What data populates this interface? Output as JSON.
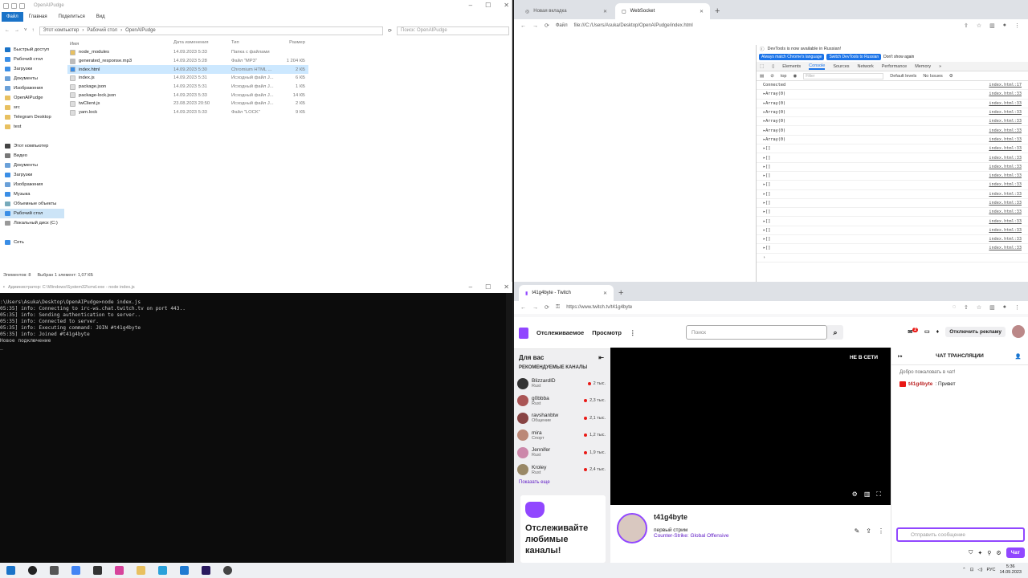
{
  "explorer": {
    "title": "OpenAIPudge",
    "ribbon": [
      "Файл",
      "Главная",
      "Поделиться",
      "Вид"
    ],
    "path": [
      "Этот компьютер",
      "Рабочий стол",
      "OpenAIPudge"
    ],
    "search_placeholder": "Поиск: OpenAIPudge",
    "nav": [
      {
        "label": "Быстрый доступ",
        "icon": "star-icon"
      },
      {
        "label": "Рабочий стол",
        "icon": "desktop-folder-icon"
      },
      {
        "label": "Загрузки",
        "icon": "download-folder-icon"
      },
      {
        "label": "Документы",
        "icon": "documents-folder-icon"
      },
      {
        "label": "Изображения",
        "icon": "pictures-folder-icon"
      },
      {
        "label": "OpenAIPudge",
        "icon": "folder-icon"
      },
      {
        "label": "src",
        "icon": "folder-icon"
      },
      {
        "label": "Telegram Desktop",
        "icon": "folder-icon"
      },
      {
        "label": "test",
        "icon": "folder-icon"
      },
      {
        "label": "",
        "icon": ""
      },
      {
        "label": "Этот компьютер",
        "icon": "computer-icon"
      },
      {
        "label": "Видео",
        "icon": "video-folder-icon"
      },
      {
        "label": "Документы",
        "icon": "documents-folder-icon"
      },
      {
        "label": "Загрузки",
        "icon": "download-folder-icon"
      },
      {
        "label": "Изображения",
        "icon": "pictures-folder-icon"
      },
      {
        "label": "Музыка",
        "icon": "music-icon"
      },
      {
        "label": "Объемные объекты",
        "icon": "3d-objects-icon"
      },
      {
        "label": "Рабочий стол",
        "icon": "desktop-folder-icon"
      },
      {
        "label": "Локальный диск (C:)",
        "icon": "disk-icon"
      },
      {
        "label": "",
        "icon": ""
      },
      {
        "label": "Сеть",
        "icon": "network-icon"
      }
    ],
    "columns": [
      "Имя",
      "Дата изменения",
      "Тип",
      "Размер"
    ],
    "files": [
      {
        "name": "node_modules",
        "date": "14.09.2023 5:33",
        "type": "Папка с файлами",
        "size": ""
      },
      {
        "name": "generated_response.mp3",
        "date": "14.09.2023 5:28",
        "type": "Файл \"MP3\"",
        "size": "1 204 КБ"
      },
      {
        "name": "index.html",
        "date": "14.09.2023 5:30",
        "type": "Chromium HTML ...",
        "size": "2 КБ"
      },
      {
        "name": "index.js",
        "date": "14.09.2023 5:31",
        "type": "Исходный файл J...",
        "size": "6 КБ"
      },
      {
        "name": "package.json",
        "date": "14.09.2023 5:31",
        "type": "Исходный файл J...",
        "size": "1 КБ"
      },
      {
        "name": "package-lock.json",
        "date": "14.09.2023 5:33",
        "type": "Исходный файл J...",
        "size": "14 КБ"
      },
      {
        "name": "twClient.js",
        "date": "23.08.2023 20:50",
        "type": "Исходный файл J...",
        "size": "2 КБ"
      },
      {
        "name": "yarn.lock",
        "date": "14.09.2023 5:33",
        "type": "Файл \"LOCK\"",
        "size": "9 КБ"
      }
    ],
    "status_items": "Элементов: 8",
    "status_selected": "Выбран 1 элемент: 1,07 КБ"
  },
  "browser1": {
    "tabs": [
      "Новая вкладка",
      "WebSocket"
    ],
    "url_prefix": "Файл",
    "url": "file:///C:/Users/Asuka/Desktop/OpenAIPudge/index.html",
    "devtools_banner": "DevTools is now available in Russian!",
    "btn_match": "Always match Chrome's language",
    "btn_switch": "Switch DevTools to Russian",
    "btn_dont": "Don't show again",
    "dt_tabs": [
      "Elements",
      "Console",
      "Sources",
      "Network",
      "Performance",
      "Memory"
    ],
    "context": "top",
    "filter_placeholder": "Filter",
    "levels": "Default levels",
    "issues": "No Issues",
    "console": [
      {
        "text": "Connected",
        "src": "index.html:17"
      },
      {
        "text": "▸Array(0)",
        "src": "index.html:33"
      },
      {
        "text": "▸Array(0)",
        "src": "index.html:33"
      },
      {
        "text": "▸Array(0)",
        "src": "index.html:33"
      },
      {
        "text": "▸Array(0)",
        "src": "index.html:33"
      },
      {
        "text": "▸Array(0)",
        "src": "index.html:33"
      },
      {
        "text": "▸Array(0)",
        "src": "index.html:33"
      },
      {
        "text": "▸[]",
        "src": "index.html:33"
      },
      {
        "text": "▸[]",
        "src": "index.html:33"
      },
      {
        "text": "▸[]",
        "src": "index.html:33"
      },
      {
        "text": "▸[]",
        "src": "index.html:33"
      },
      {
        "text": "▸[]",
        "src": "index.html:33"
      },
      {
        "text": "▸[]",
        "src": "index.html:33"
      },
      {
        "text": "▸[]",
        "src": "index.html:33"
      },
      {
        "text": "▸[]",
        "src": "index.html:33"
      },
      {
        "text": "▸[]",
        "src": "index.html:33"
      },
      {
        "text": "▸[]",
        "src": "index.html:33"
      },
      {
        "text": "▸[]",
        "src": "index.html:33"
      },
      {
        "text": "▸[]",
        "src": "index.html:33"
      },
      {
        "text": "›",
        "src": ""
      }
    ]
  },
  "terminal": {
    "title": "Администратор: C:\\Windows\\System32\\cmd.exe - node  index.js",
    "lines": [
      ":\\Users\\Asuka\\Desktop\\OpenAIPudge>node index.js",
      "05:35] info: Connecting to irc-ws.chat.twitch.tv on port 443..",
      "05:35] info: Sending authentication to server..",
      "05:35] info: Connected to server.",
      "05:35] info: Executing command: JOIN #t41g4byte",
      "05:35] info: Joined #t41g4byte",
      "Новое подключение"
    ]
  },
  "browser2": {
    "tab": "t41g4byte - Twitch",
    "url": "https://www.twitch.tv/t41g4byte",
    "nav_following": "Отслеживаемое",
    "nav_browse": "Просмотр",
    "search_placeholder": "Поиск",
    "notif_count": "2",
    "ads_btn": "Отключить рекламу",
    "side_title": "Для вас",
    "side_sub": "РЕКОМЕНДУЕМЫЕ КАНАЛЫ",
    "channels": [
      {
        "name": "BlizzardID",
        "game": "Rust",
        "viewers": "2 тыс."
      },
      {
        "name": "g0bbba",
        "game": "Rust",
        "viewers": "2,3 тыс."
      },
      {
        "name": "ravshanbtw",
        "game": "Общение",
        "viewers": "2,1 тыс."
      },
      {
        "name": "mira",
        "game": "Спорт",
        "viewers": "1,2 тыс."
      },
      {
        "name": "Jennifer",
        "game": "Rust",
        "viewers": "1,9 тыс."
      },
      {
        "name": "Kroley",
        "game": "Rust",
        "viewers": "2,4 тыс."
      }
    ],
    "show_more": "Показать еще",
    "promo": "Отслеживайте любимые каналы!",
    "offline": "НЕ В СЕТИ",
    "streamer": "t41g4byte",
    "stream_title": "первый стрим",
    "game": "Counter-Strike: Global Offensive",
    "chat_title": "ЧАТ ТРАНСЛЯЦИИ",
    "chat_welcome": "Добро пожаловать в чат!",
    "chat_user": "t41g4byte",
    "chat_text": ": Привет",
    "chat_placeholder": "Отправить сообщение",
    "chat_send": "Чат"
  },
  "taskbar": {
    "lang": "РУС",
    "time": "5:36",
    "date": "14.09.2023",
    "apps": [
      "start-icon",
      "search-icon",
      "task-view-icon",
      "chrome-icon",
      "terminal-icon",
      "pink-app-icon",
      "explorer-icon",
      "telegram-icon",
      "vscode-icon",
      "after-effects-icon",
      "obs-icon"
    ]
  },
  "colors": {
    "twitch": "#9147ff",
    "explorer_accent": "#1a73c8",
    "live": "#e91916"
  }
}
